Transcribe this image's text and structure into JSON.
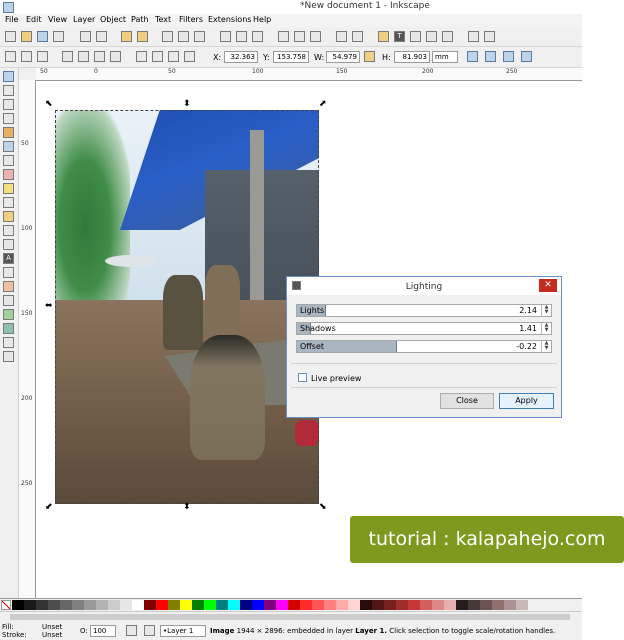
{
  "window": {
    "title": "*New document 1 - Inkscape"
  },
  "menu": [
    "File",
    "Edit",
    "View",
    "Layer",
    "Object",
    "Path",
    "Text",
    "Filters",
    "Extensions",
    "Help"
  ],
  "controls": {
    "x_label": "X:",
    "x_value": "32.363",
    "y_label": "Y:",
    "y_value": "153.758",
    "w_label": "W:",
    "w_value": "54.979",
    "h_label": "H:",
    "h_value": "81.903",
    "unit": "mm"
  },
  "ruler_h": [
    "50",
    "0",
    "50",
    "100",
    "150",
    "200",
    "250"
  ],
  "ruler_v": [
    "50",
    "100",
    "150",
    "200",
    "250"
  ],
  "dialog": {
    "title": "Lighting",
    "close_glyph": "✕",
    "sliders": [
      {
        "name": "Lights",
        "value": "2.14",
        "fill": 0.11
      },
      {
        "name": "Shadows",
        "value": "1.41",
        "fill": 0.05
      },
      {
        "name": "Offset",
        "value": "-0.22",
        "fill": 0.39
      }
    ],
    "live_preview": "Live preview",
    "close_button": "Close",
    "apply_button": "Apply"
  },
  "status": {
    "fill_label": "Fill:",
    "fill_value": "Unset",
    "stroke_label": "Stroke:",
    "stroke_value": "Unset",
    "opacity_label": "O:",
    "opacity_value": "100",
    "layer": "•Layer 1",
    "message_bold": "Image",
    "message": "1944 × 2896: embedded in layer",
    "message_layer": "Layer 1.",
    "message_tail": "Click selection to toggle scale/rotation handles."
  },
  "banner": {
    "text": "tutorial : kalapahejo.com"
  },
  "colors": {
    "banner": "#7e9a1e",
    "dialog_border": "#6a8fc0",
    "close_red": "#c42b1c"
  },
  "palette": [
    "#000000",
    "#1a1a1a",
    "#333333",
    "#4d4d4d",
    "#666666",
    "#808080",
    "#999999",
    "#b3b3b3",
    "#cccccc",
    "#e6e6e6",
    "#ffffff",
    "#800000",
    "#ff0000",
    "#808000",
    "#ffff00",
    "#008000",
    "#00ff00",
    "#008080",
    "#00ffff",
    "#000080",
    "#0000ff",
    "#800080",
    "#ff00ff",
    "#d40000",
    "#ff2a2a",
    "#ff5555",
    "#ff8080",
    "#ffaaaa",
    "#ffd5d5",
    "#280b0b",
    "#501616",
    "#782121",
    "#a02c2c",
    "#c83737",
    "#d35f5f",
    "#de8787",
    "#e9afaf",
    "#241c1c",
    "#483737",
    "#6c5353",
    "#916f6f",
    "#ac9393",
    "#c8b7b7"
  ]
}
